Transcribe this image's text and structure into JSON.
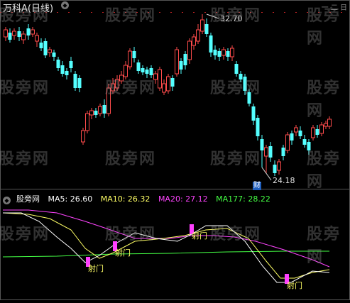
{
  "header": {
    "title": "万科A(日线)",
    "collapse_glyph": "◆",
    "window_controls": "一 二 日"
  },
  "price_marks": {
    "high": "32.70",
    "low": "24.18",
    "finance_badge": "财"
  },
  "indicator": {
    "name": "股旁网",
    "ma5": "MA5: 26.60",
    "ma10": "MA10: 26.32",
    "ma20": "MA20: 27.12",
    "ma177": "MA177: 28.22",
    "signal_label": "射门",
    "signals": [
      "射门",
      "射门",
      "射门",
      "射门"
    ]
  },
  "watermark": "股旁网",
  "colors": {
    "background": "#000000",
    "candle_up": "#ff4b4b",
    "candle_down": "#54ffff",
    "ma5": "#ffffff",
    "ma10": "#ffff66",
    "ma20": "#ff44ff",
    "ma177": "#44ff44",
    "signal_bar": "#ff40ff"
  }
}
